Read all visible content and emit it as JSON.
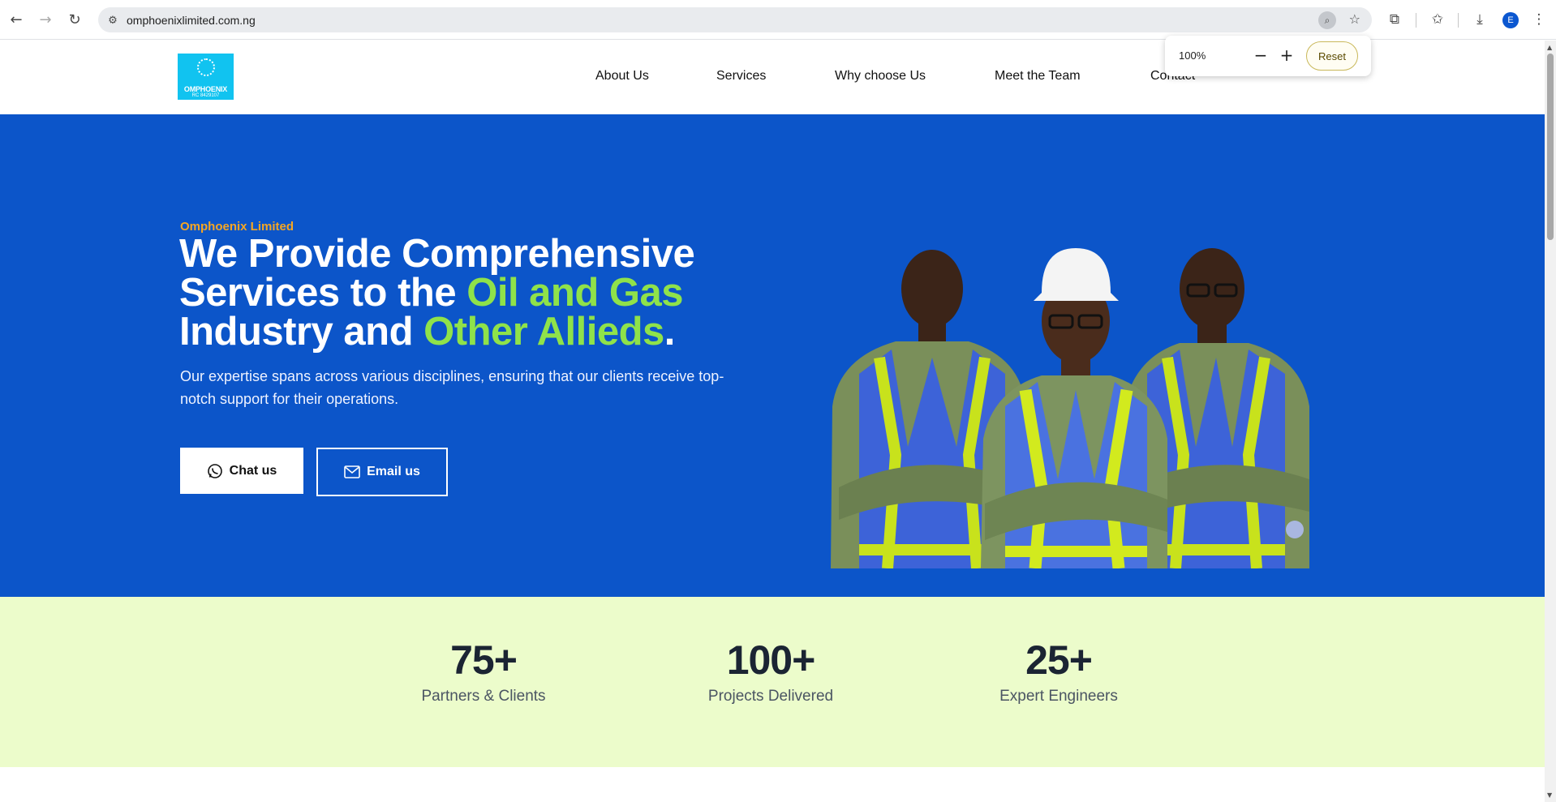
{
  "browser": {
    "url": "omphoenixlimited.com.ng",
    "profile_initial": "E",
    "zoom": {
      "level": "100%",
      "decrease": "−",
      "increase": "+",
      "reset_label": "Reset"
    }
  },
  "header": {
    "logo": {
      "name": "OMPHOENIX",
      "rc": "RC 8429107"
    },
    "nav": [
      "About Us",
      "Services",
      "Why choose Us",
      "Meet the Team",
      "Contact"
    ]
  },
  "hero": {
    "eyebrow": "Omphoenix Limited",
    "headline": {
      "part1": "We Provide Comprehensive Services to the ",
      "accent1": "Oil and Gas",
      "part2": " Industry and ",
      "accent2": "Other Allieds",
      "part3": "."
    },
    "lead": "Our expertise spans across various disciplines, ensuring that our clients receive top-notch support for their operations.",
    "buttons": {
      "chat": "Chat us",
      "email": "Email us"
    },
    "colors": {
      "background": "#0c55c9",
      "accent": "#8fe24a",
      "eyebrow": "#f5a623"
    }
  },
  "stats": [
    {
      "value": "75+",
      "label": "Partners & Clients"
    },
    {
      "value": "100+",
      "label": "Projects Delivered"
    },
    {
      "value": "25+",
      "label": "Expert Engineers"
    }
  ]
}
